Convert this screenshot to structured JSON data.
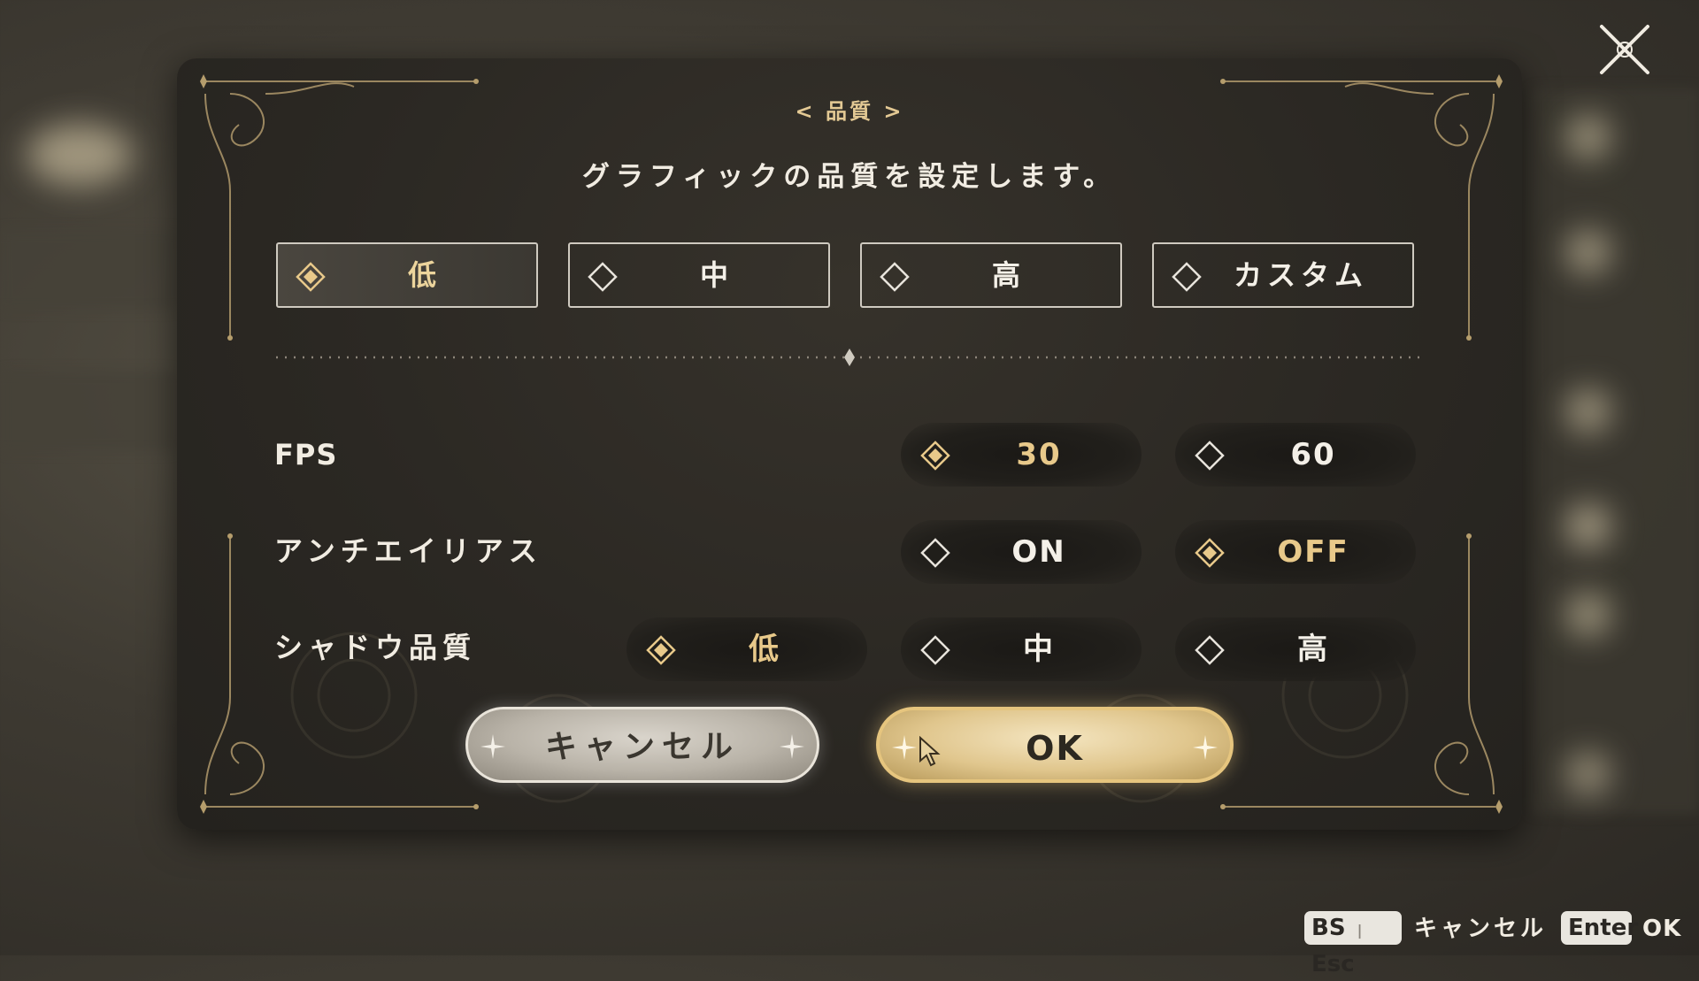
{
  "header": {
    "close_icon": "close-x-icon"
  },
  "dialog": {
    "subtitle": "< 品質 >",
    "description": "グラフィックの品質を設定します。",
    "presets": [
      {
        "label": "低",
        "selected": true
      },
      {
        "label": "中",
        "selected": false
      },
      {
        "label": "高",
        "selected": false
      },
      {
        "label": "カスタム",
        "selected": false
      }
    ],
    "settings": {
      "fps": {
        "label": "FPS",
        "options": [
          {
            "label": "30",
            "selected": true
          },
          {
            "label": "60",
            "selected": false
          }
        ]
      },
      "antialias": {
        "label": "アンチエイリアス",
        "options": [
          {
            "label": "ON",
            "selected": false
          },
          {
            "label": "OFF",
            "selected": true
          }
        ]
      },
      "shadow": {
        "label": "シャドウ品質",
        "options": [
          {
            "label": "低",
            "selected": true
          },
          {
            "label": "中",
            "selected": false
          },
          {
            "label": "高",
            "selected": false
          }
        ]
      }
    },
    "buttons": {
      "cancel": "キャンセル",
      "ok": "OK"
    }
  },
  "footer": {
    "key_bs": "BS",
    "key_sep": "|",
    "key_esc": "Esc",
    "cancel_label": "キャンセル",
    "key_enter": "Enter",
    "ok_label": "OK"
  },
  "colors": {
    "accent_gold": "#e3c994",
    "dialog_bg": "#2b2823",
    "selected_text": "#e8c98a"
  }
}
